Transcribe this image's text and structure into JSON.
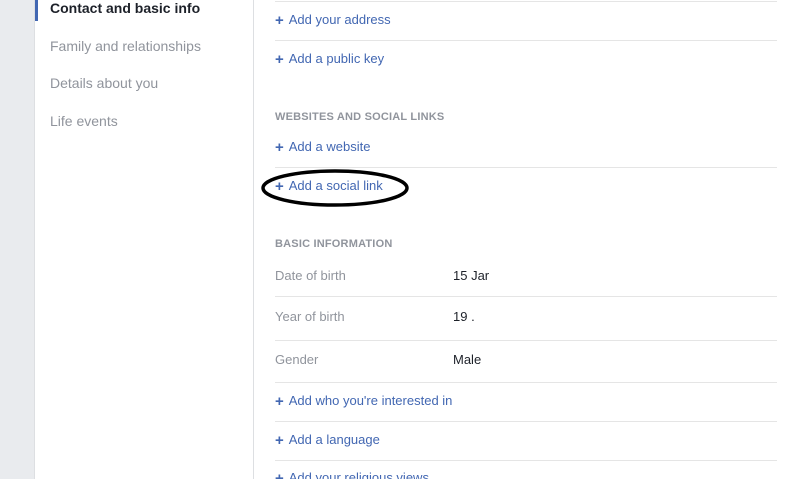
{
  "sidebar": {
    "items": [
      {
        "label": "Contact and basic info",
        "active": true
      },
      {
        "label": "Family and relationships",
        "active": false
      },
      {
        "label": "Details about you",
        "active": false
      },
      {
        "label": "Life events",
        "active": false
      }
    ]
  },
  "contact": {
    "add_address": "Add your address",
    "add_public_key": "Add a public key"
  },
  "websites": {
    "header": "WEBSITES AND SOCIAL LINKS",
    "add_website": "Add a website",
    "add_social_link": "Add a social link"
  },
  "basic_info": {
    "header": "BASIC INFORMATION",
    "rows": [
      {
        "label": "Date of birth",
        "value": "15 Jar"
      },
      {
        "label": "Year of birth",
        "value": "19  ."
      },
      {
        "label": "Gender",
        "value": "Male"
      }
    ],
    "add_interested_in": "Add who you're interested in",
    "add_language": "Add a language",
    "add_religious_views": "Add your religious views"
  },
  "plus_glyph": "+",
  "colors": {
    "link": "#4267b2",
    "muted": "#90949c",
    "text": "#1d2129",
    "gutter": "#e9ebee"
  }
}
